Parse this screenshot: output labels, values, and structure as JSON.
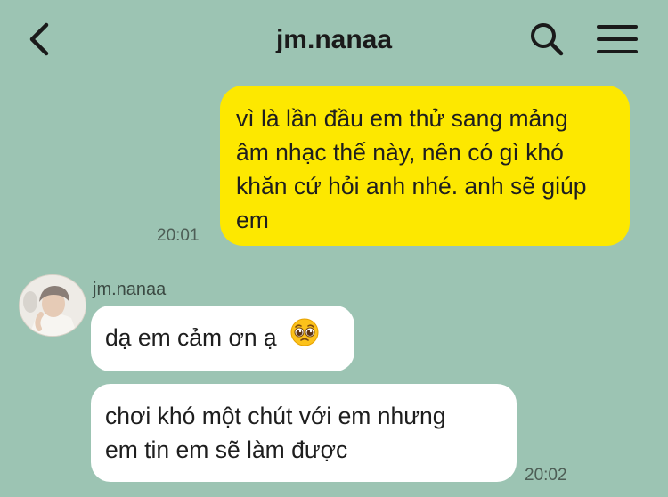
{
  "header": {
    "title": "jm.nanaa"
  },
  "icons": {
    "back": "chevron-left-icon",
    "search": "search-icon",
    "menu": "hamburger-menu-icon"
  },
  "messages": {
    "outgoing": {
      "lines": [
        "vì là lần đầu em thử sang mảng",
        "âm nhạc thế này, nên có gì khó",
        "khăn cứ hỏi anh nhé. anh sẽ giúp",
        "em"
      ],
      "time": "20:01"
    },
    "incoming": {
      "sender": "jm.nanaa",
      "first": {
        "text": "dạ em cảm ơn ạ",
        "emoji": "pleading-face-emoji"
      },
      "second": {
        "lines": [
          "chơi khó một chút với em nhưng",
          "em tin em sẽ làm được"
        ]
      },
      "time": "20:02"
    }
  },
  "colors": {
    "background": "#9cc4b3",
    "outgoing_bubble": "#fde800",
    "incoming_bubble": "#ffffff"
  }
}
